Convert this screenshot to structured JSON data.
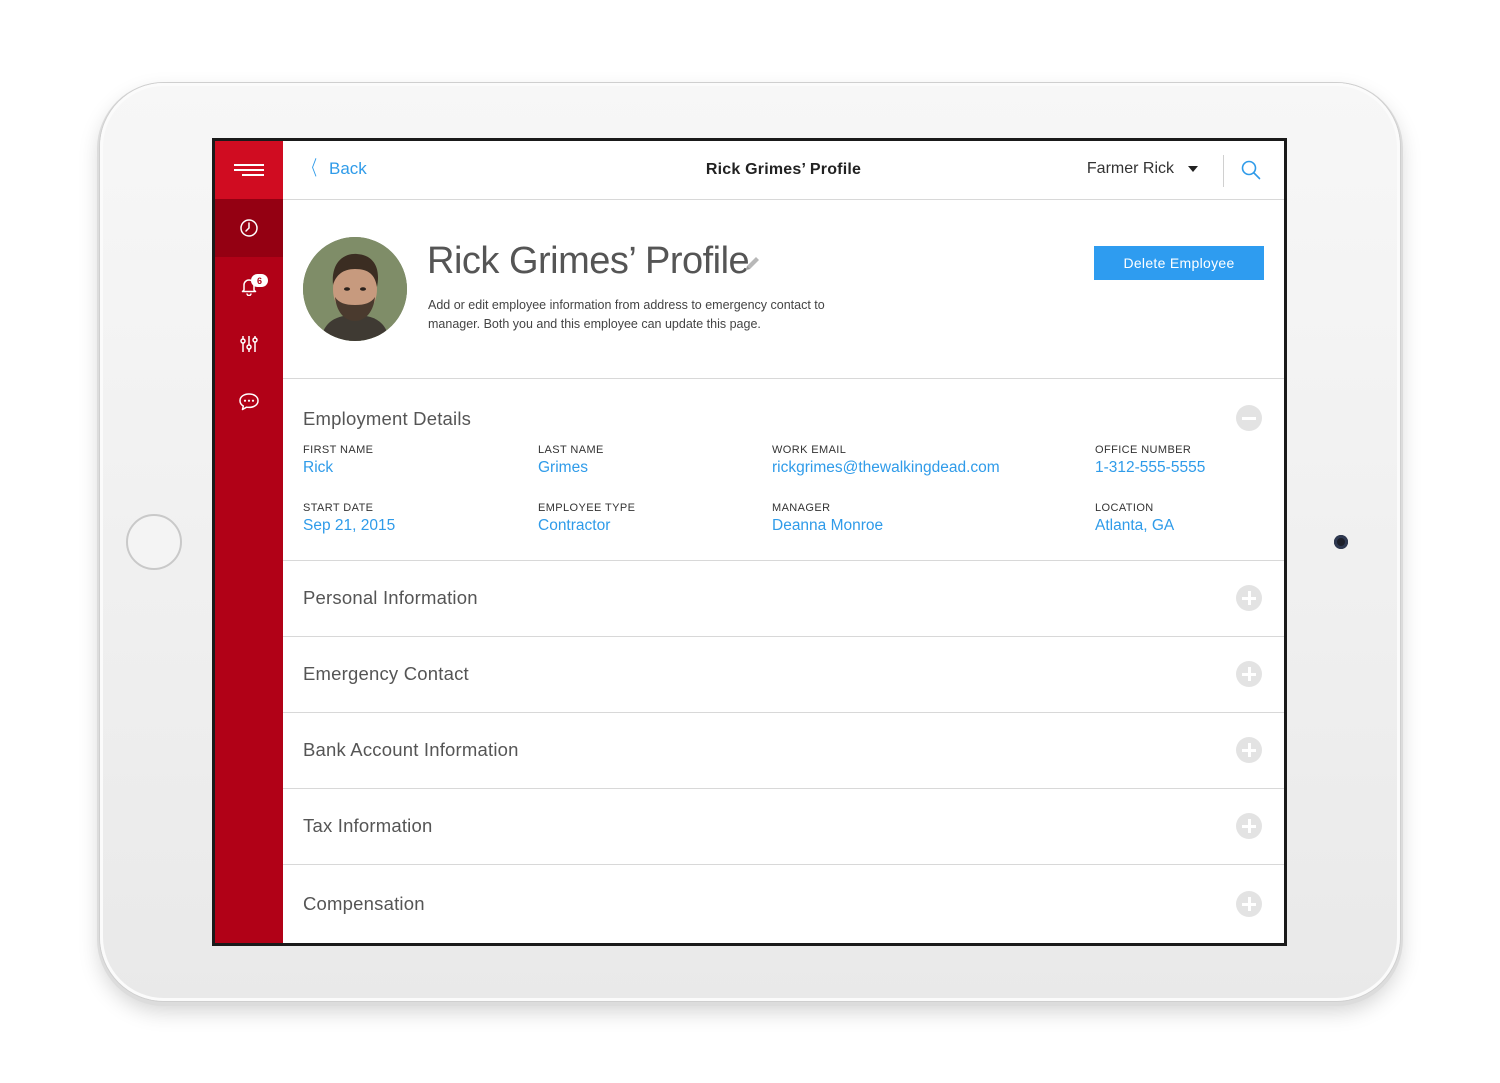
{
  "sidebar": {
    "items": [
      {
        "icon": "clock-icon",
        "active": true
      },
      {
        "icon": "bell-icon",
        "badge": "6"
      },
      {
        "icon": "sliders-icon"
      },
      {
        "icon": "chat-icon"
      }
    ]
  },
  "topbar": {
    "back_label": "Back",
    "title": "Rick Grimes’ Profile",
    "user_name": "Farmer Rick"
  },
  "profile": {
    "title": "Rick Grimes’ Profile",
    "description": "Add or edit employee information from address to emergency contact to manager. Both you and this employee can update this page.",
    "delete_label": "Delete Employee"
  },
  "employment": {
    "title": "Employment Details",
    "fields": [
      {
        "label": "FIRST NAME",
        "value": "Rick"
      },
      {
        "label": "LAST NAME",
        "value": "Grimes"
      },
      {
        "label": "WORK EMAIL",
        "value": "rickgrimes@thewalkingdead.com"
      },
      {
        "label": "OFFICE NUMBER",
        "value": "1-312-555-5555"
      },
      {
        "label": "START DATE",
        "value": "Sep 21, 2015"
      },
      {
        "label": "EMPLOYEE TYPE",
        "value": "Contractor"
      },
      {
        "label": "MANAGER",
        "value": "Deanna Monroe"
      },
      {
        "label": "LOCATION",
        "value": "Atlanta, GA"
      }
    ]
  },
  "sections": [
    {
      "title": "Personal Information"
    },
    {
      "title": "Emergency Contact"
    },
    {
      "title": "Bank Account Information"
    },
    {
      "title": "Tax Information"
    },
    {
      "title": "Compensation"
    }
  ],
  "colors": {
    "sidebar": "#b10117",
    "sidebar_menu": "#d00c21",
    "accent": "#2f9be9",
    "button": "#2e9cf0"
  }
}
